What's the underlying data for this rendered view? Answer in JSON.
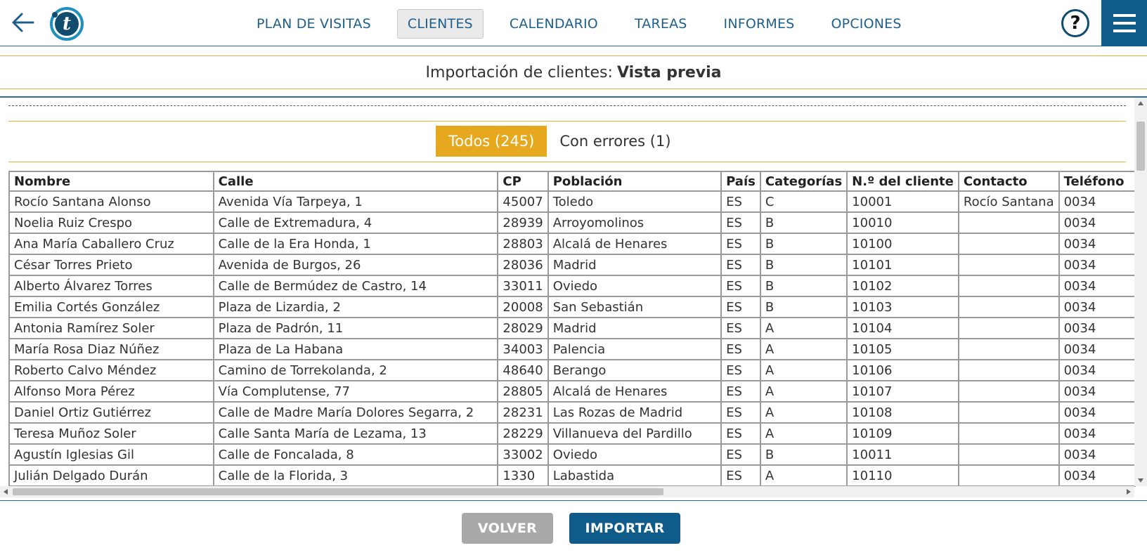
{
  "nav": {
    "items": [
      {
        "label": "PLAN DE VISITAS",
        "name": "nav-plan-de-visitas",
        "active": false
      },
      {
        "label": "CLIENTES",
        "name": "nav-clientes",
        "active": true
      },
      {
        "label": "CALENDARIO",
        "name": "nav-calendario",
        "active": false
      },
      {
        "label": "TAREAS",
        "name": "nav-tareas",
        "active": false
      },
      {
        "label": "INFORMES",
        "name": "nav-informes",
        "active": false
      },
      {
        "label": "OPCIONES",
        "name": "nav-opciones",
        "active": false
      }
    ],
    "help_label": "?",
    "logo_letter": "t"
  },
  "title": {
    "prefix": "Importación de clientes:",
    "strong": "Vista previa"
  },
  "filters": {
    "all": "Todos (245)",
    "errors": "Con errores (1)"
  },
  "table": {
    "columns": [
      "Nombre",
      "Calle",
      "CP",
      "Población",
      "País",
      "Categorías",
      "N.º del cliente",
      "Contacto",
      "Teléfono"
    ],
    "rows": [
      [
        "Rocío Santana Alonso",
        "Avenida Vía Tarpeya, 1",
        "45007",
        "Toledo",
        "ES",
        "C",
        "10001",
        "Rocío Santana",
        "0034"
      ],
      [
        "Noelia Ruiz Crespo",
        "Calle de Extremadura, 4",
        "28939",
        "Arroyomolinos",
        "ES",
        "B",
        "10010",
        "",
        "0034"
      ],
      [
        "Ana María Caballero Cruz",
        "Calle de la Era Honda, 1",
        "28803",
        "Alcalá de Henares",
        "ES",
        "B",
        "10100",
        "",
        "0034"
      ],
      [
        "César Torres Prieto",
        "Avenida de Burgos, 26",
        "28036",
        "Madrid",
        "ES",
        "B",
        "10101",
        "",
        "0034"
      ],
      [
        "Alberto Álvarez Torres",
        "Calle de Bermúdez de Castro, 14",
        "33011",
        "Oviedo",
        "ES",
        "B",
        "10102",
        "",
        "0034"
      ],
      [
        "Emilia Cortés González",
        "Plaza de Lizardia, 2",
        "20008",
        "San Sebastián",
        "ES",
        "B",
        "10103",
        "",
        "0034"
      ],
      [
        "Antonia Ramírez Soler",
        "Plaza de Padrón, 11",
        "28029",
        "Madrid",
        "ES",
        "A",
        "10104",
        "",
        "0034"
      ],
      [
        "María Rosa Diaz Núñez",
        "Plaza de La Habana",
        "34003",
        "Palencia",
        "ES",
        "A",
        "10105",
        "",
        "0034"
      ],
      [
        "Roberto Calvo Méndez",
        "Camino de Torrekolanda, 2",
        "48640",
        "Berango",
        "ES",
        "A",
        "10106",
        "",
        "0034"
      ],
      [
        "Alfonso Mora Pérez",
        "Vía Complutense, 77",
        "28805",
        "Alcalá de Henares",
        "ES",
        "A",
        "10107",
        "",
        "0034"
      ],
      [
        "Daniel Ortiz Gutiérrez",
        "Calle de Madre María Dolores Segarra, 2",
        "28231",
        "Las Rozas de Madrid",
        "ES",
        "A",
        "10108",
        "",
        "0034"
      ],
      [
        "Teresa Muñoz Soler",
        "Calle Santa María de Lezama, 13",
        "28229",
        "Villanueva del Pardillo",
        "ES",
        "A",
        "10109",
        "",
        "0034"
      ],
      [
        "Agustín Iglesias Gil",
        "Calle de Foncalada, 8",
        "33002",
        "Oviedo",
        "ES",
        "B",
        "10011",
        "",
        "0034"
      ],
      [
        "Julián Delgado Durán",
        "Calle de la Florida, 3",
        "1330",
        "Labastida",
        "ES",
        "A",
        "10110",
        "",
        "0034"
      ]
    ]
  },
  "buttons": {
    "back": "VOLVER",
    "import": "IMPORTAR"
  },
  "colors": {
    "brand_blue": "#0f5c8a",
    "accent_gold": "#e6a81f",
    "nav_text": "#1f5f8b"
  }
}
